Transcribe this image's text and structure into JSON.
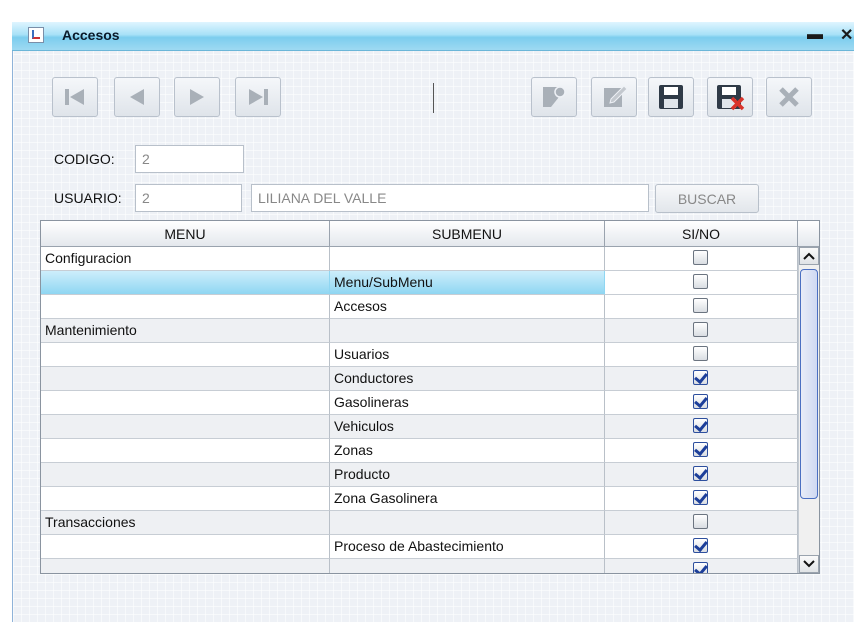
{
  "window": {
    "title": "Accesos",
    "minimize_glyph": "▬",
    "close_glyph": "✕"
  },
  "toolbar": {
    "buttons": [
      {
        "name": "first-record",
        "icon": "skip-first-icon",
        "enabled": false
      },
      {
        "name": "previous-record",
        "icon": "previous-icon",
        "enabled": false
      },
      {
        "name": "next-record",
        "icon": "next-icon",
        "enabled": false
      },
      {
        "name": "last-record",
        "icon": "skip-last-icon",
        "enabled": false
      },
      {
        "name": "new-record",
        "icon": "new-note-icon",
        "enabled": false
      },
      {
        "name": "edit-record",
        "icon": "edit-pencil-icon",
        "enabled": false
      },
      {
        "name": "save-record",
        "icon": "save-disk-icon",
        "enabled": true
      },
      {
        "name": "delete-record",
        "icon": "delete-disk-icon",
        "enabled": true
      },
      {
        "name": "close-form",
        "icon": "close-x-icon",
        "enabled": false
      }
    ]
  },
  "form": {
    "codigo_label": "CODIGO:",
    "codigo_value": "2",
    "usuario_label": "USUARIO:",
    "usuario_id": "2",
    "usuario_name": "LILIANA DEL VALLE",
    "buscar_label": "BUSCAR"
  },
  "table": {
    "headers": [
      "MENU",
      "SUBMENU",
      "SI/NO"
    ],
    "rows": [
      {
        "menu": "Configuracion",
        "submenu": "",
        "checked": false
      },
      {
        "menu": "",
        "submenu": "Menu/SubMenu",
        "checked": false,
        "selected": true
      },
      {
        "menu": "",
        "submenu": "Accesos",
        "checked": false
      },
      {
        "menu": "Mantenimiento",
        "submenu": "",
        "checked": false
      },
      {
        "menu": "",
        "submenu": "Usuarios",
        "checked": false
      },
      {
        "menu": "",
        "submenu": "Conductores",
        "checked": true
      },
      {
        "menu": "",
        "submenu": "Gasolineras",
        "checked": true
      },
      {
        "menu": "",
        "submenu": "Vehiculos",
        "checked": true
      },
      {
        "menu": "",
        "submenu": "Zonas",
        "checked": true
      },
      {
        "menu": "",
        "submenu": "Producto",
        "checked": true
      },
      {
        "menu": "",
        "submenu": "Zona Gasolinera",
        "checked": true
      },
      {
        "menu": "Transacciones",
        "submenu": "",
        "checked": false
      },
      {
        "menu": "",
        "submenu": "Proceso de Abastecimiento",
        "checked": true
      },
      {
        "menu": "",
        "submenu": "",
        "checked": true
      }
    ]
  },
  "colors": {
    "titlebar": "#7ccdee",
    "selection": "#8fd6f2",
    "check": "#1d3f9a",
    "delete_red": "#d9332b"
  }
}
